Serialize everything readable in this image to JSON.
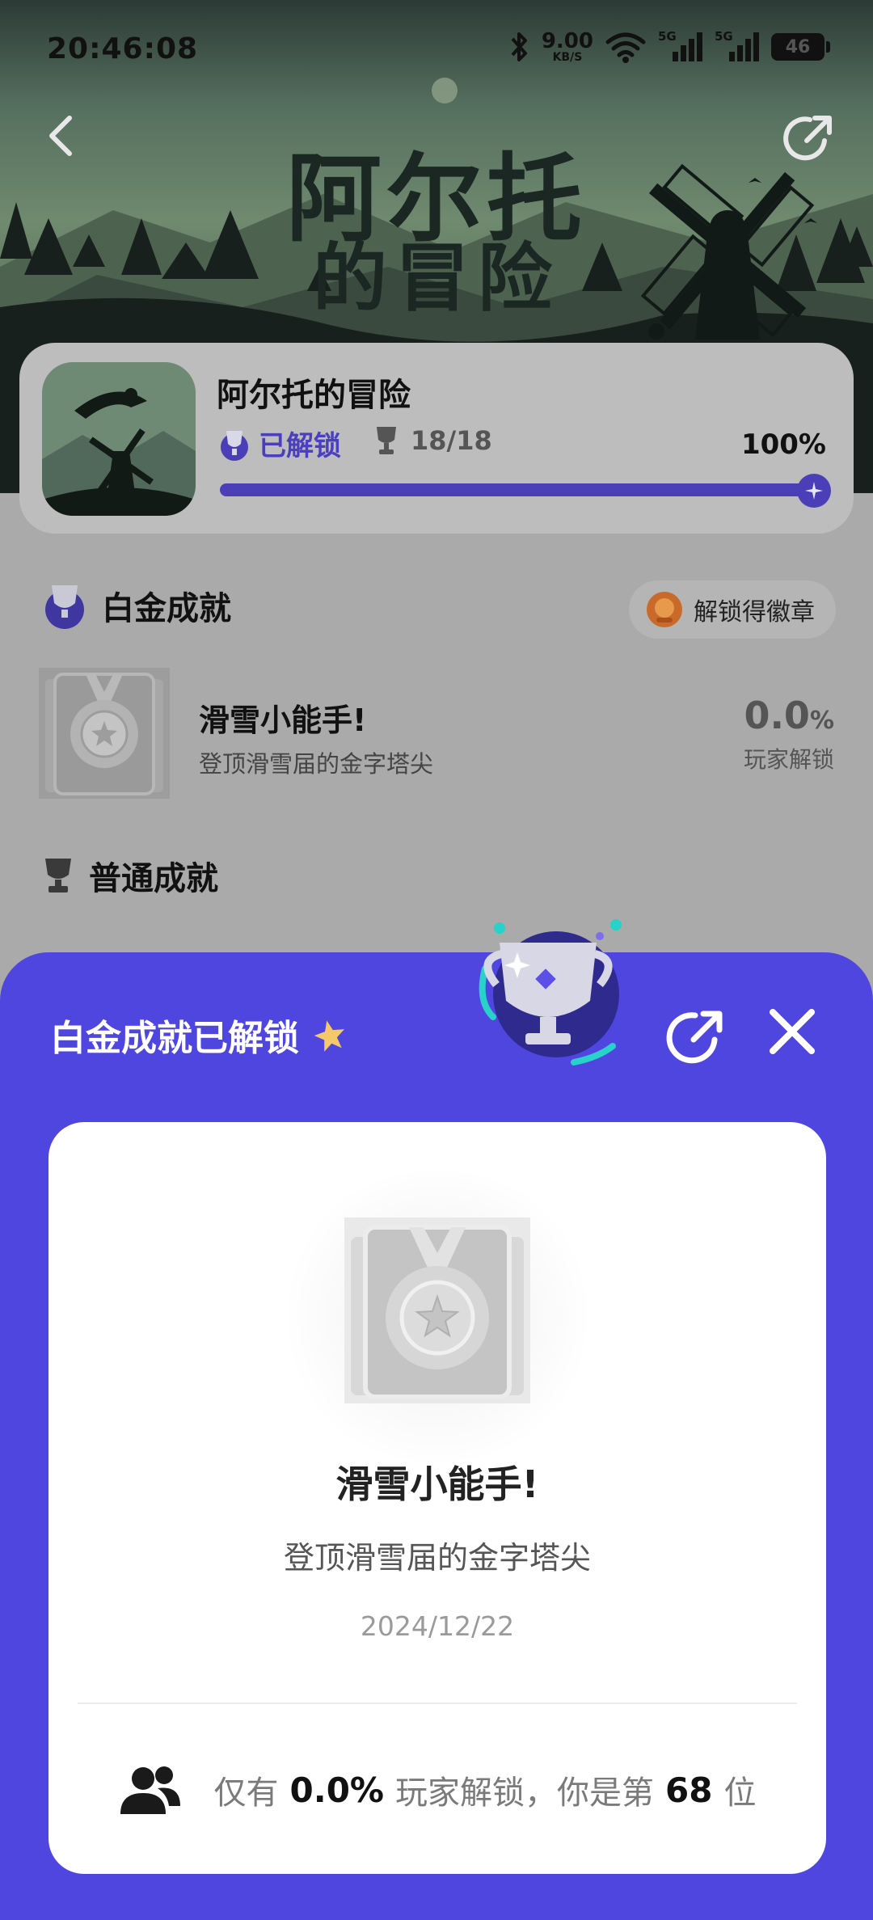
{
  "status_bar": {
    "time": "20:46:08",
    "net_speed_value": "9.00",
    "net_speed_unit": "KB/S",
    "signal_1_label": "5G",
    "signal_2_label": "5G",
    "battery": "46"
  },
  "banner": {
    "title_line1": "阿尔托",
    "title_line2": "的冒险"
  },
  "game": {
    "name": "阿尔托的冒险",
    "unlock_label": "已解锁",
    "trophy_count": "18/18",
    "percent": "100%",
    "progress": 1.0
  },
  "platinum_section": {
    "title": "白金成就",
    "badge_label": "解锁得徽章"
  },
  "achievement": {
    "title": "滑雪小能手!",
    "desc": "登顶滑雪届的金字塔尖",
    "rate_num": "0.0",
    "rate_unit": "%",
    "rate_label": "玩家解锁"
  },
  "normal_section": {
    "title": "普通成就"
  },
  "sheet": {
    "title": "白金成就已解锁",
    "modal": {
      "title": "滑雪小能手!",
      "desc": "登顶滑雪届的金字塔尖",
      "date": "2024/12/22",
      "foot_prefix": "仅有",
      "foot_rate": "0.0%",
      "foot_mid": "玩家解锁，你是第",
      "foot_rank": "68",
      "foot_suffix": "位"
    }
  },
  "colors": {
    "accent": "#4f46e0",
    "progress_fill": "#4b3fb8",
    "overlay_gray": "#aaaaaa"
  }
}
